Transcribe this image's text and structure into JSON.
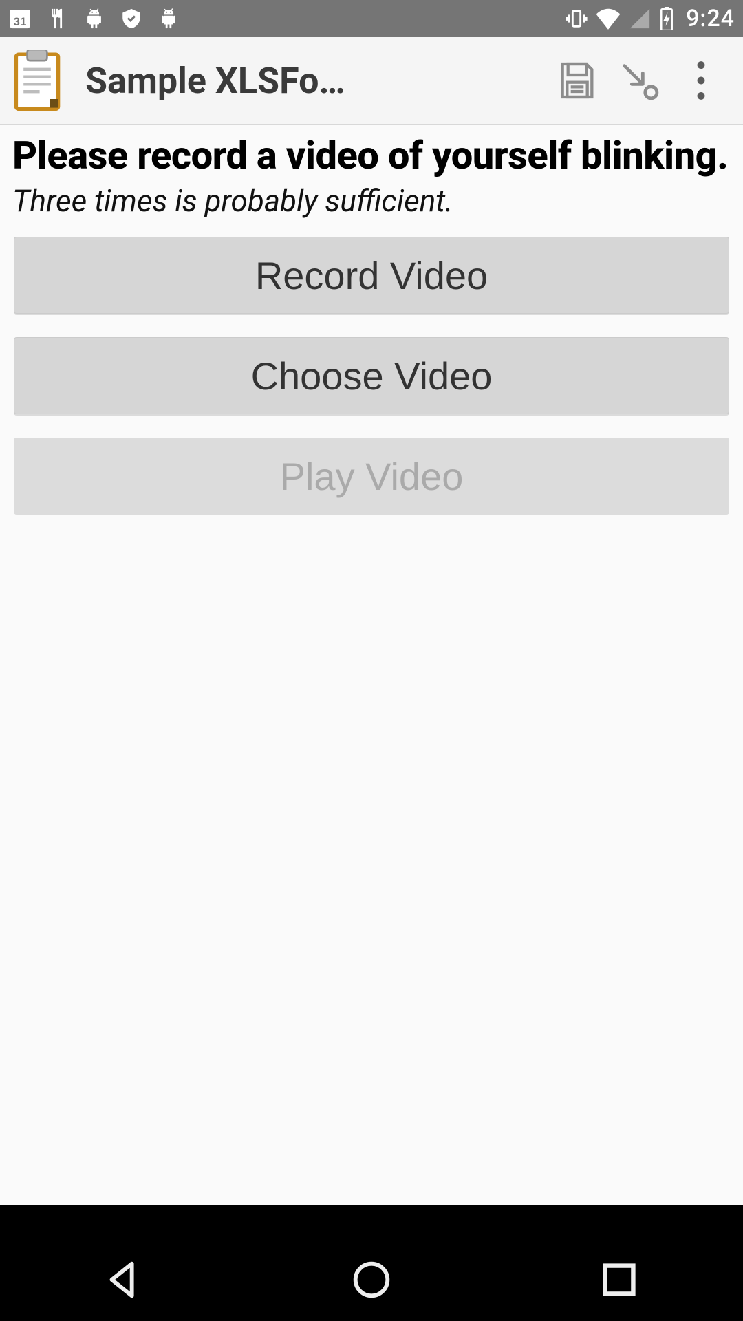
{
  "status": {
    "clock": "9:24",
    "icons": {
      "calendar_day": "31"
    }
  },
  "appbar": {
    "title": "Sample XLSFo…"
  },
  "page": {
    "title": "Please record a video of yourself blinking.",
    "hint": "Three times is probably sufficient.",
    "buttons": {
      "record": "Record Video",
      "choose": "Choose Video",
      "play": "Play Video"
    },
    "play_enabled": false
  }
}
